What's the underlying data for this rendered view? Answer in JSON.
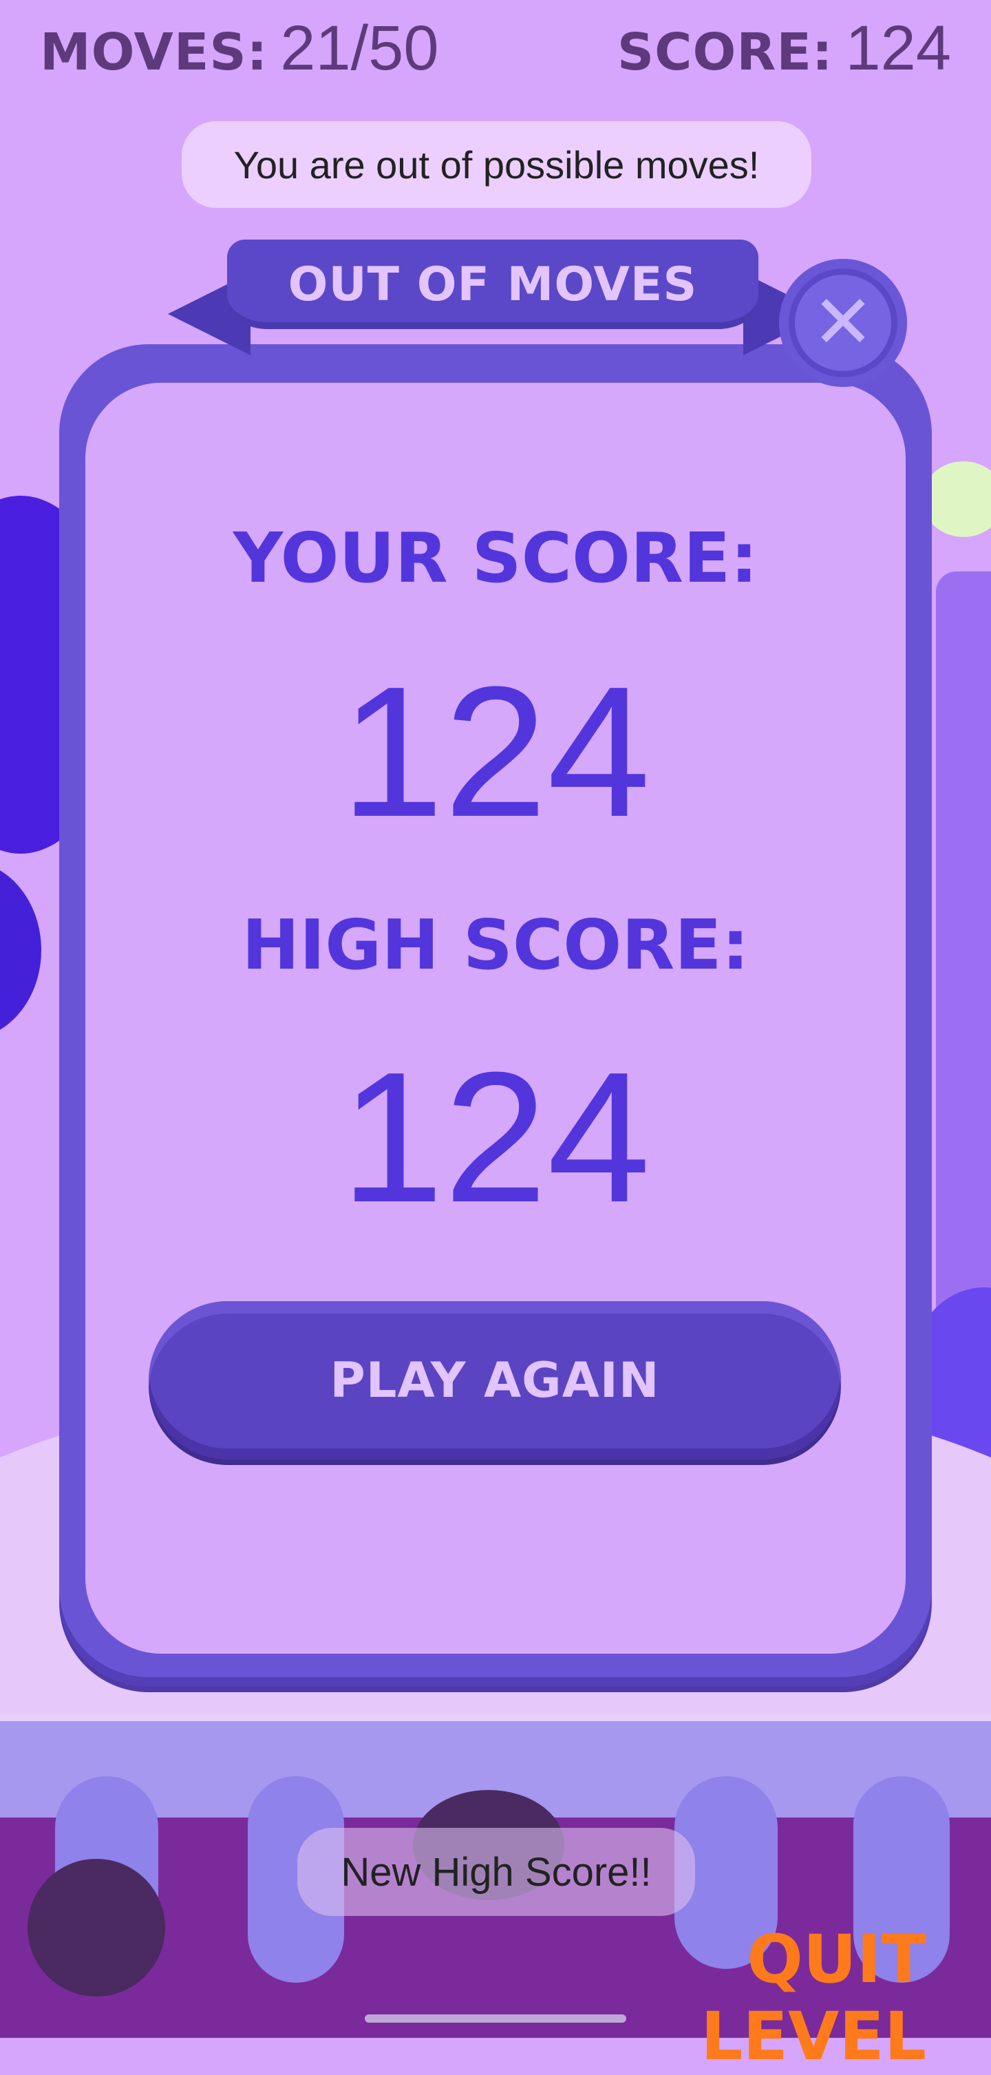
{
  "hud": {
    "moves_label": "MOVES:",
    "moves_value": "21/50",
    "score_label": "SCORE:",
    "score_value": "124"
  },
  "toast_top": "You are out of possible moves!",
  "modal": {
    "title": "OUT OF MOVES",
    "close_icon": "close-icon",
    "your_score_label": "YOUR SCORE:",
    "your_score_value": "124",
    "high_score_label": "HIGH SCORE:",
    "high_score_value": "124",
    "play_again_label": "PLAY AGAIN"
  },
  "toast_bottom": "New High Score!!",
  "quit_label": "QUIT LEVEL",
  "colors": {
    "background": "#d5a6fb",
    "modal_frame": "#6a54d6",
    "score_text": "#5236dc",
    "quit": "#ff7a1a"
  }
}
